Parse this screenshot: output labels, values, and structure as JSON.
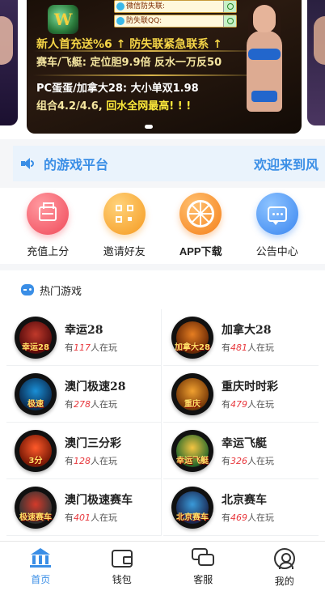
{
  "banner": {
    "contact_1": "微信防失联:",
    "contact_2": "防失联QQ:",
    "promo_line_1": "新人首充送%6 ↑ 防失联紧急联系 ↑",
    "promo_line_2": "赛车/飞艇: 定位胆9.9倍 反水一万反50",
    "promo_line_3": "PC蛋蛋/加拿大28: 大小单双1.98",
    "promo_line_4a": "组合4.2/4.6, ",
    "promo_line_4b": "回水全网最高! ! !"
  },
  "notice": {
    "text_1": "的游戏平台",
    "text_2": "欢迎来到风"
  },
  "actions": [
    {
      "label": "充值上分",
      "icon": "wallet-icon",
      "color": "#f04a5a"
    },
    {
      "label": "邀请好友",
      "icon": "qr-code-icon",
      "color": "#f59a20"
    },
    {
      "label": "APP下载",
      "icon": "orange-slice-icon",
      "color": "#f5801a"
    },
    {
      "label": "公告中心",
      "icon": "chat-bubble-icon",
      "color": "#3a86f0"
    }
  ],
  "hot": {
    "title": "热门游戏",
    "games": [
      {
        "name": "幸运28",
        "prefix": "有",
        "count": "117",
        "suffix": "人在玩",
        "badge_text": "幸运28"
      },
      {
        "name": "加拿大28",
        "prefix": "有",
        "count": "481",
        "suffix": "人在玩",
        "badge_text": "加拿大28"
      },
      {
        "name": "澳门极速28",
        "prefix": "有",
        "count": "278",
        "suffix": "人在玩",
        "badge_text": "极速"
      },
      {
        "name": "重庆时时彩",
        "prefix": "有",
        "count": "479",
        "suffix": "人在玩",
        "badge_text": "重庆"
      },
      {
        "name": "澳门三分彩",
        "prefix": "有",
        "count": "128",
        "suffix": "人在玩",
        "badge_text": "3分"
      },
      {
        "name": "幸运飞艇",
        "prefix": "有",
        "count": "326",
        "suffix": "人在玩",
        "badge_text": "幸运飞艇"
      },
      {
        "name": "澳门极速赛车",
        "prefix": "有",
        "count": "401",
        "suffix": "人在玩",
        "badge_text": "极速赛车"
      },
      {
        "name": "北京赛车",
        "prefix": "有",
        "count": "469",
        "suffix": "人在玩",
        "badge_text": "北京赛车"
      }
    ]
  },
  "tabbar": {
    "home": "首页",
    "wallet": "钱包",
    "service": "客服",
    "mine": "我的"
  },
  "colors": {
    "accent": "#3a8ee6",
    "player_count": "#e8383d"
  }
}
